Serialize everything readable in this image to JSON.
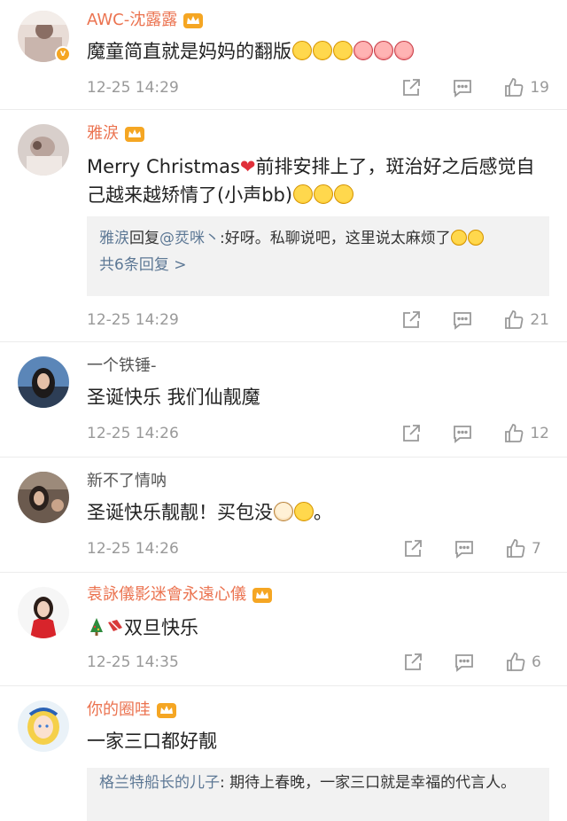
{
  "comments": [
    {
      "name": "AWC-沈露露",
      "name_color": "orange",
      "content": "魔童简直就是妈妈的翻版",
      "emojis": [
        "laugh",
        "laugh",
        "laugh",
        "heart",
        "heart",
        "heart"
      ],
      "time": "12-25 14:29",
      "likes": "19"
    },
    {
      "name": "雅涙",
      "name_color": "orange",
      "content_a": "Merry Christmas",
      "content_b": "前排安排上了，斑治好之后感觉自己越来越矫情了(小声bb)",
      "reply_user": "雅涙",
      "reply_text_a": "回复",
      "reply_mention": "@烎咪丶",
      "reply_text_b": ":好呀。私聊说吧，这里说太麻烦了",
      "reply_more": "共6条回复 >",
      "time": "12-25 14:29",
      "likes": "21"
    },
    {
      "name": "一个铁锤-",
      "name_color": "gray",
      "content": "圣诞快乐 我们仙靓魔",
      "time": "12-25 14:26",
      "likes": "12"
    },
    {
      "name": "新不了情呐",
      "name_color": "gray",
      "content_a": "圣诞快乐靓靓！买包没",
      "content_b": "。",
      "time": "12-25 14:26",
      "likes": "7"
    },
    {
      "name": "袁詠儀影迷會永遠心儀",
      "name_color": "orange",
      "content": "双旦快乐",
      "time": "12-25 14:35",
      "likes": "6"
    },
    {
      "name": "你的圈哇",
      "name_color": "orange",
      "content": "一家三口都好靓",
      "reply_user": "格兰特船长的儿子",
      "reply_text": ": 期待上春晚，一家三口就是幸福的代言人。"
    }
  ],
  "colors": {
    "vip_name": "#eb7350",
    "reply_link": "#5d7895",
    "meta_text": "#999999",
    "reply_bg": "#f2f2f2"
  },
  "icons": [
    "share-icon",
    "comment-icon",
    "like-icon",
    "crown-icon"
  ]
}
